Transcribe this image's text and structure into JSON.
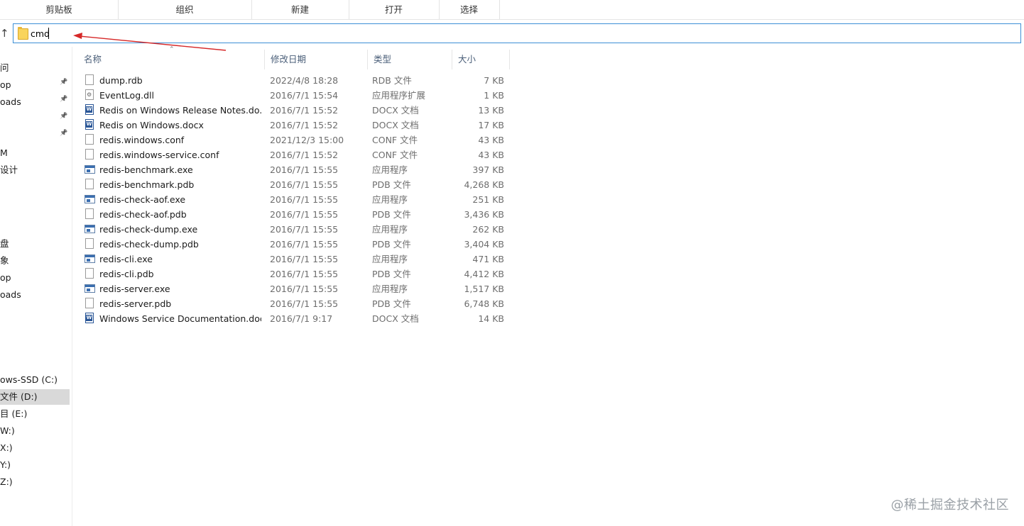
{
  "ribbon": {
    "groups": [
      "剪贴板",
      "组织",
      "新建",
      "打开",
      "选择"
    ]
  },
  "address_bar": {
    "value": "cmd"
  },
  "columns": {
    "name": "名称",
    "date": "修改日期",
    "type": "类型",
    "size": "大小"
  },
  "nav": {
    "items": [
      "问",
      "op",
      "oads",
      "",
      "",
      "M",
      "设计",
      "",
      "",
      "",
      "",
      "盘",
      "象",
      "op",
      "oads",
      "",
      "",
      "",
      "",
      "ows-SSD (C:)",
      "文件 (D:)",
      "目 (E:)",
      "W:)",
      "X:)",
      "Y:)",
      "Z:)"
    ]
  },
  "files": [
    {
      "name": "dump.rdb",
      "date": "2022/4/8 18:28",
      "type": "RDB 文件",
      "size": "7 KB",
      "icon": "file-icon"
    },
    {
      "name": "EventLog.dll",
      "date": "2016/7/1 15:54",
      "type": "应用程序扩展",
      "size": "1 KB",
      "icon": "dll-icon"
    },
    {
      "name": "Redis on Windows Release Notes.do...",
      "date": "2016/7/1 15:52",
      "type": "DOCX 文档",
      "size": "13 KB",
      "icon": "word-doc-icon"
    },
    {
      "name": "Redis on Windows.docx",
      "date": "2016/7/1 15:52",
      "type": "DOCX 文档",
      "size": "17 KB",
      "icon": "word-doc-icon"
    },
    {
      "name": "redis.windows.conf",
      "date": "2021/12/3 15:00",
      "type": "CONF 文件",
      "size": "43 KB",
      "icon": "file-icon"
    },
    {
      "name": "redis.windows-service.conf",
      "date": "2016/7/1 15:52",
      "type": "CONF 文件",
      "size": "43 KB",
      "icon": "file-icon"
    },
    {
      "name": "redis-benchmark.exe",
      "date": "2016/7/1 15:55",
      "type": "应用程序",
      "size": "397 KB",
      "icon": "exe-icon"
    },
    {
      "name": "redis-benchmark.pdb",
      "date": "2016/7/1 15:55",
      "type": "PDB 文件",
      "size": "4,268 KB",
      "icon": "file-icon"
    },
    {
      "name": "redis-check-aof.exe",
      "date": "2016/7/1 15:55",
      "type": "应用程序",
      "size": "251 KB",
      "icon": "exe-icon"
    },
    {
      "name": "redis-check-aof.pdb",
      "date": "2016/7/1 15:55",
      "type": "PDB 文件",
      "size": "3,436 KB",
      "icon": "file-icon"
    },
    {
      "name": "redis-check-dump.exe",
      "date": "2016/7/1 15:55",
      "type": "应用程序",
      "size": "262 KB",
      "icon": "exe-icon"
    },
    {
      "name": "redis-check-dump.pdb",
      "date": "2016/7/1 15:55",
      "type": "PDB 文件",
      "size": "3,404 KB",
      "icon": "file-icon"
    },
    {
      "name": "redis-cli.exe",
      "date": "2016/7/1 15:55",
      "type": "应用程序",
      "size": "471 KB",
      "icon": "exe-icon"
    },
    {
      "name": "redis-cli.pdb",
      "date": "2016/7/1 15:55",
      "type": "PDB 文件",
      "size": "4,412 KB",
      "icon": "file-icon"
    },
    {
      "name": "redis-server.exe",
      "date": "2016/7/1 15:55",
      "type": "应用程序",
      "size": "1,517 KB",
      "icon": "exe-icon"
    },
    {
      "name": "redis-server.pdb",
      "date": "2016/7/1 15:55",
      "type": "PDB 文件",
      "size": "6,748 KB",
      "icon": "file-icon"
    },
    {
      "name": "Windows Service Documentation.docx",
      "date": "2016/7/1 9:17",
      "type": "DOCX 文档",
      "size": "14 KB",
      "icon": "word-doc-icon"
    }
  ],
  "watermark": "@稀土掘金技术社区",
  "colors": {
    "address_border": "#3c8fd6",
    "annotation_arrow": "#d62828",
    "selected_nav": "#d9d9d9",
    "header_text": "#4c607a"
  }
}
